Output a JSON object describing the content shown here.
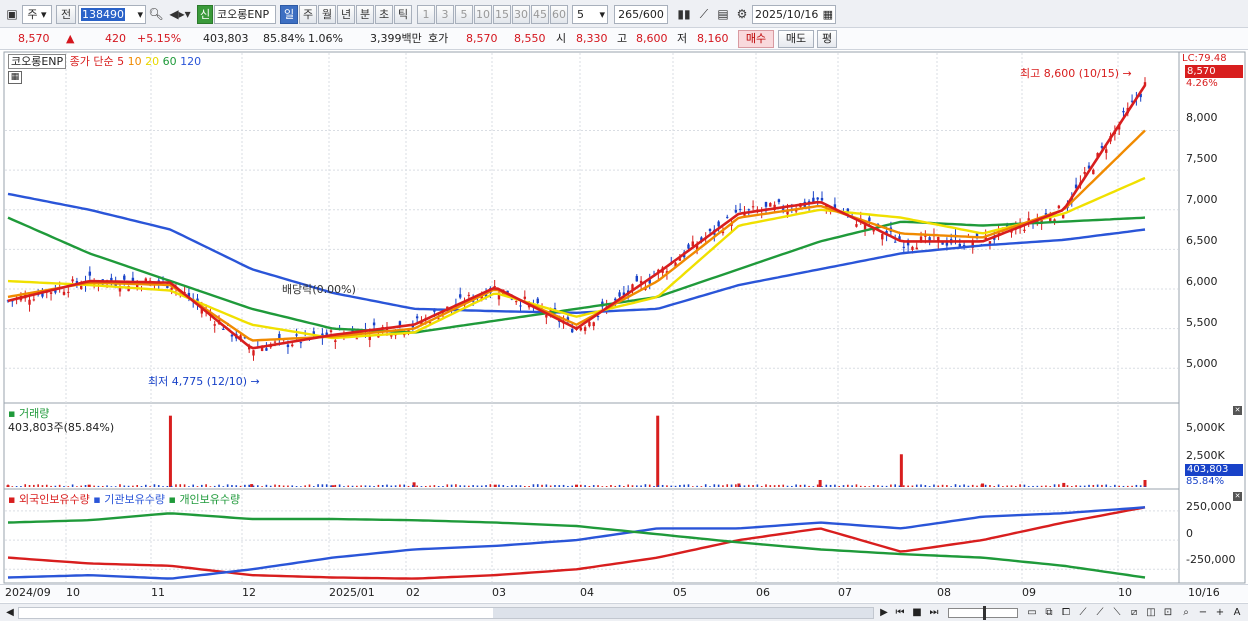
{
  "toolbar": {
    "market": "주",
    "prev_label": "전",
    "code": "138490",
    "flag": "신",
    "name": "코오롱ENP",
    "period_tabs": [
      "일",
      "주",
      "월",
      "년",
      "분",
      "초",
      "틱"
    ],
    "minute_options": [
      "1",
      "3",
      "5",
      "10",
      "15",
      "30",
      "45",
      "60"
    ],
    "interval_value": "5",
    "count": "265",
    "count_max": "/600",
    "date": "2025/10/16"
  },
  "quote": {
    "price": "8,570",
    "change": "420",
    "change_pct": "+5.15%",
    "volume": "403,803",
    "volume_ratio": "85.84%",
    "turnover": "1.06%",
    "amount": "3,399백만",
    "ask_label": "호가",
    "ask": "8,570",
    "bid": "8,550",
    "open_label": "시",
    "open": "8,330",
    "high_label": "고",
    "high": "8,600",
    "low_label": "저",
    "low": "8,160",
    "buy_label": "매수",
    "sell_label": "매도",
    "eval_label": "평"
  },
  "legend": {
    "name": "코오롱ENP",
    "ma_label": "종가 단순",
    "ma_periods": [
      "5",
      "10",
      "20",
      "60",
      "120"
    ],
    "ma_colors": [
      "#d81e1e",
      "#f08a00",
      "#f0e000",
      "#1f9a3a",
      "#2a55d8"
    ]
  },
  "annotations": {
    "high": "최고 8,600 (10/15)",
    "low": "최저 4,775 (12/10)",
    "dividend": "배당락(0.00%)"
  },
  "right_axis": {
    "lc": "LC:79.48",
    "current_price": "8,570",
    "current_pct": "4.26%",
    "price_ticks": [
      "8,000",
      "7,500",
      "7,000",
      "6,500",
      "6,000",
      "5,500",
      "5,000"
    ],
    "volume_ticks": [
      "5,000K",
      "2,500K"
    ],
    "volume_value": "403,803",
    "volume_pct": "85.84%",
    "holding_ticks": [
      "250,000",
      "0",
      "-250,000"
    ]
  },
  "volume_panel": {
    "title": "거래량",
    "value": "403,803주(85.84%)"
  },
  "holding_panel": {
    "series_labels": [
      "외국인보유수량",
      "기관보유수량",
      "개인보유수량"
    ],
    "colors": [
      "#d81e1e",
      "#2a55d8",
      "#1f9a3a"
    ]
  },
  "x_axis": {
    "labels": [
      "2024/09",
      "10",
      "11",
      "12",
      "2025/01",
      "02",
      "03",
      "04",
      "05",
      "06",
      "07",
      "08",
      "09",
      "10"
    ],
    "current_date": "10/16"
  },
  "chart_data": [
    {
      "type": "line",
      "title": "",
      "xlabel": "",
      "ylabel": "",
      "ylim": [
        4650,
        8750
      ],
      "x": [
        "2024/09",
        "10",
        "11",
        "12",
        "2025/01",
        "02",
        "03",
        "04",
        "05",
        "06",
        "07",
        "08",
        "09",
        "10",
        "10/15"
      ],
      "series": [
        {
          "name": "5",
          "values": [
            5850,
            6100,
            6080,
            5250,
            5420,
            5550,
            6020,
            5500,
            6200,
            6950,
            7100,
            6600,
            6600,
            7000,
            8570
          ]
        },
        {
          "name": "10",
          "values": [
            5900,
            6080,
            6050,
            5350,
            5400,
            5500,
            6000,
            5550,
            6100,
            6900,
            7050,
            6700,
            6650,
            7000,
            8000
          ]
        },
        {
          "name": "20",
          "values": [
            6100,
            6050,
            5980,
            5550,
            5380,
            5450,
            5950,
            5650,
            5900,
            6800,
            7000,
            6900,
            6700,
            6950,
            7400
          ]
        },
        {
          "name": "60",
          "values": [
            6900,
            6450,
            6100,
            5750,
            5500,
            5450,
            5600,
            5750,
            5900,
            6250,
            6600,
            6850,
            6800,
            6850,
            6900
          ]
        },
        {
          "name": "120",
          "values": [
            7200,
            7000,
            6750,
            6250,
            5950,
            5750,
            5720,
            5700,
            5750,
            6050,
            6250,
            6450,
            6550,
            6620,
            6750
          ]
        }
      ]
    },
    {
      "type": "bar",
      "title": "",
      "xlabel": "",
      "ylabel": "",
      "ylim": [
        0,
        6500
      ],
      "categories": [
        "2024/09",
        "10",
        "11",
        "12",
        "2025/01",
        "02",
        "03",
        "04",
        "05",
        "06",
        "07",
        "08",
        "09",
        "10",
        "10/15"
      ],
      "values": [
        150,
        200,
        6100,
        250,
        150,
        400,
        200,
        200,
        6100,
        300,
        600,
        2800,
        300,
        350,
        600
      ]
    },
    {
      "type": "line",
      "title": "",
      "xlabel": "",
      "ylabel": "",
      "ylim": [
        -350000,
        300000
      ],
      "x": [
        "2024/09",
        "10",
        "11",
        "12",
        "2025/01",
        "02",
        "03",
        "04",
        "05",
        "06",
        "07",
        "08",
        "09",
        "10",
        "10/15"
      ],
      "series": [
        {
          "name": "외국인보유수량",
          "values": [
            -150000,
            -200000,
            -220000,
            -300000,
            -320000,
            -330000,
            -300000,
            -250000,
            -150000,
            0,
            100000,
            -100000,
            0,
            150000,
            280000
          ]
        },
        {
          "name": "기관보유수량",
          "values": [
            -320000,
            -300000,
            -330000,
            -250000,
            -150000,
            -80000,
            -50000,
            0,
            100000,
            100000,
            150000,
            100000,
            200000,
            230000,
            280000
          ]
        },
        {
          "name": "개인보유수량",
          "values": [
            150000,
            170000,
            230000,
            180000,
            180000,
            170000,
            150000,
            120000,
            50000,
            -20000,
            -80000,
            -120000,
            -150000,
            -220000,
            -320000
          ]
        }
      ]
    }
  ]
}
